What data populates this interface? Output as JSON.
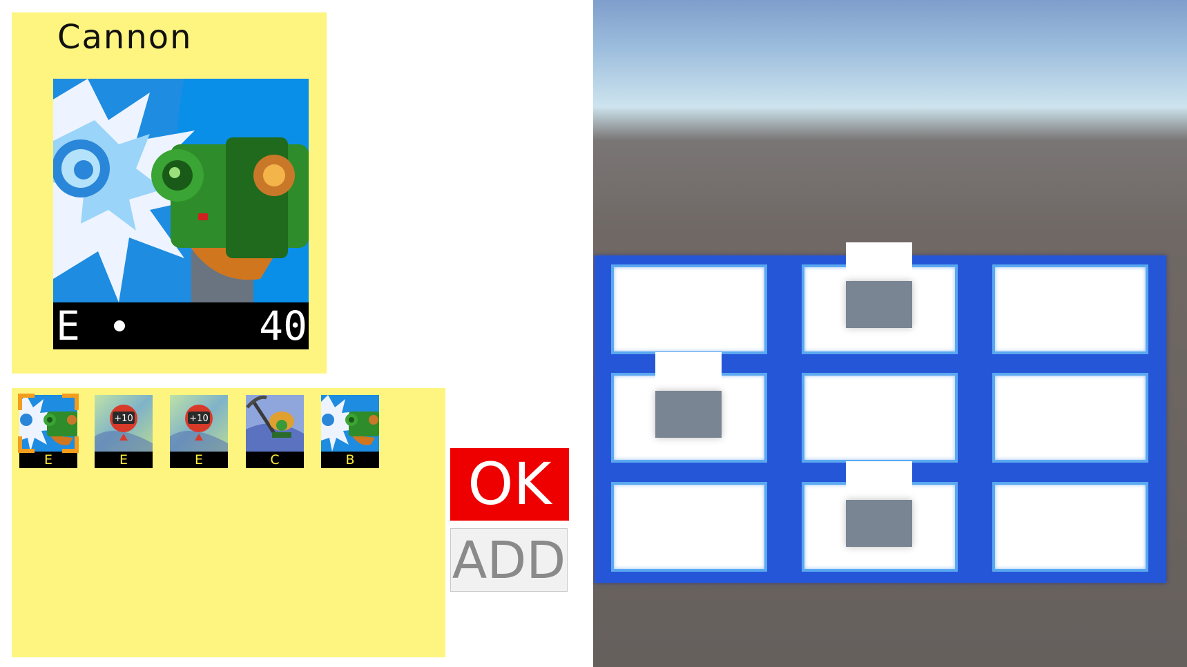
{
  "selected_card": {
    "name": "Cannon",
    "code": "E",
    "damage": "40",
    "art_icon": "cannon-chip-art"
  },
  "folder": {
    "chips": [
      {
        "art_icon": "cannon-chip-art",
        "code": "E",
        "selected": true
      },
      {
        "art_icon": "atk-plus-10-chip-art",
        "code": "E",
        "selected": false
      },
      {
        "art_icon": "atk-plus-10-chip-art",
        "code": "E",
        "selected": false
      },
      {
        "art_icon": "pickaxe-mettaur-chip-art",
        "code": "C",
        "selected": false
      },
      {
        "art_icon": "cannon-chip-art",
        "code": "B",
        "selected": false
      }
    ]
  },
  "buttons": {
    "ok_label": "OK",
    "add_label": "ADD"
  },
  "battle_field": {
    "panel_rows": 3,
    "panel_cols": 3,
    "panel_color": "#2656d8"
  },
  "colors": {
    "panel_bg": "#fdf57f",
    "ok_button": "#ee0000",
    "cursor": "#f39c1e",
    "chip_code_text": "#ffeb3b"
  }
}
